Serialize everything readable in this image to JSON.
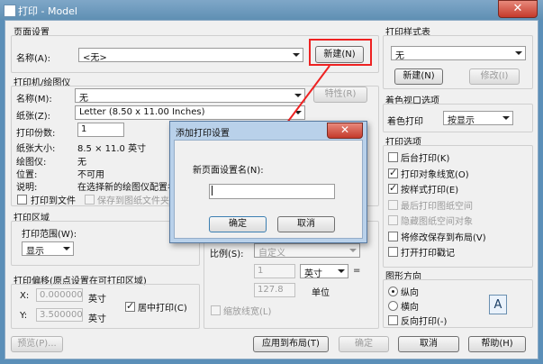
{
  "window": {
    "title": "打印 - Model",
    "close_glyph": "✕"
  },
  "page_setup": {
    "title": "页面设置",
    "name_label": "名称(A):",
    "name_value": "<无>",
    "new_button": "新建(N)"
  },
  "printer": {
    "title": "打印机/绘图仪",
    "name_label": "名称(M):",
    "name_value": "无",
    "properties_button": "特性(R)",
    "paper_label": "纸张(Z):",
    "paper_value": "Letter (8.50 x 11.00 Inches)",
    "copies_label": "打印份数:",
    "copies_value": "1",
    "paper_size_label": "纸张大小:",
    "paper_size_value": "8.5 × 11.0  英寸",
    "plotter_label": "绘图仪:",
    "plotter_value": "无",
    "location_label": "位置:",
    "location_value": "不可用",
    "description_label": "说明:",
    "description_value": "在选择新的绘图仪配置名",
    "print_to_file": "打印到文件",
    "save_to_file": "保存到图纸文件夹"
  },
  "plot_area": {
    "title": "打印区域",
    "range_label": "打印范围(W):",
    "range_value": "显示"
  },
  "plot_offset": {
    "title": "打印偏移(原点设置在可打印区域)",
    "x_label": "X:",
    "x_value": "0.000000",
    "x_unit": "英寸",
    "y_label": "Y:",
    "y_value": "3.500000",
    "y_unit": "英寸",
    "center_label": "居中打印(C)"
  },
  "plot_scale": {
    "scale_label": "比例(S):",
    "scale_value": "自定义",
    "num_value": "1",
    "unit_value": "英寸",
    "equals": "=",
    "den_value": "127.8",
    "unit_label": "单位",
    "scale_lineweights": "缩放线宽(L)"
  },
  "style_table": {
    "title": "打印样式表",
    "value": "无",
    "new_button": "新建(N)",
    "edit_button": "修改(I)"
  },
  "shaded": {
    "title": "着色视口选项",
    "label": "着色打印",
    "value": "按显示"
  },
  "options": {
    "title": "打印选项",
    "items": [
      {
        "label": "后台打印(K)",
        "checked": false,
        "enabled": true
      },
      {
        "label": "打印对象线宽(O)",
        "checked": true,
        "enabled": true
      },
      {
        "label": "按样式打印(E)",
        "checked": true,
        "enabled": true
      },
      {
        "label": "最后打印图纸空间",
        "checked": false,
        "enabled": false
      },
      {
        "label": "隐藏图纸空间对象",
        "checked": false,
        "enabled": false
      },
      {
        "label": "将修改保存到布局(V)",
        "checked": false,
        "enabled": true
      },
      {
        "label": "打开打印戳记",
        "checked": false,
        "enabled": true
      }
    ]
  },
  "orientation": {
    "title": "图形方向",
    "portrait": "纵向",
    "landscape": "横向",
    "reverse": "反向打印(-)",
    "page_glyph": "A"
  },
  "footer": {
    "preview": "预览(P)...",
    "apply_layout": "应用到布局(T)",
    "ok": "确定",
    "cancel": "取消",
    "help": "帮助(H)"
  },
  "dialog": {
    "title": "添加打印设置",
    "close_glyph": "✕",
    "prompt": "新页面设置名(N):",
    "input_value": "",
    "ok": "确定",
    "cancel": "取消"
  },
  "colors": {
    "highlight": "#ee2222",
    "titlebar": "#6f9ac0"
  }
}
